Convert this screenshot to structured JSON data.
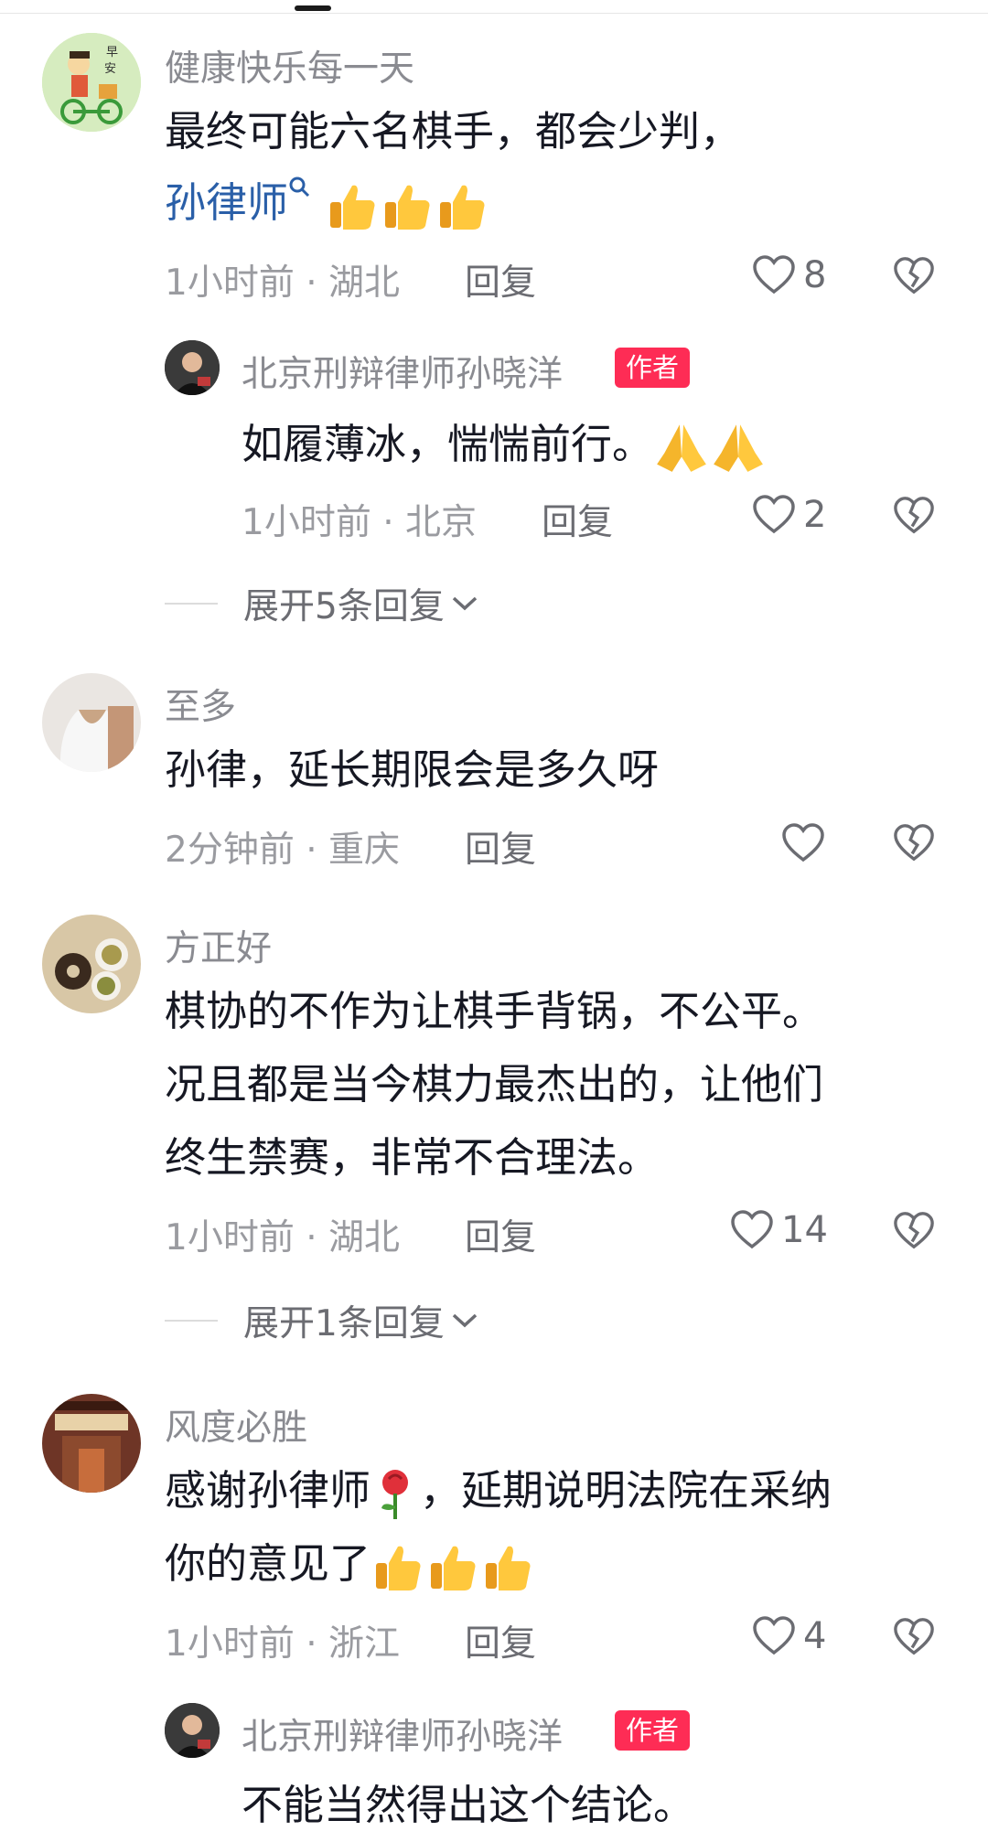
{
  "c1": {
    "user": "健康快乐每一天",
    "avatar_text": [
      "早",
      "安"
    ],
    "line1": "最终可能六名棋手，都会少判，",
    "mention": "孙律师",
    "time": "1小时前 · 湖北",
    "reply": "回复",
    "likes": "8"
  },
  "r1": {
    "user": "北京刑辩律师孙晓洋",
    "badge": "作者",
    "text": "如履薄冰，惴惴前行。",
    "time": "1小时前 · 北京",
    "reply": "回复",
    "likes": "2"
  },
  "e1": {
    "label": "展开5条回复"
  },
  "c2": {
    "user": "至多",
    "text": "孙律，延长期限会是多久呀",
    "time": "2分钟前 · 重庆",
    "reply": "回复"
  },
  "c3": {
    "user": "方正好",
    "line1": "棋协的不作为让棋手背锅，不公平。",
    "line2": "况且都是当今棋力最杰出的，让他们",
    "line3": "终生禁赛，非常不合理法。",
    "time": "1小时前 · 湖北",
    "reply": "回复",
    "likes": "14"
  },
  "e2": {
    "label": "展开1条回复"
  },
  "c4": {
    "user": "风度必胜",
    "line1a": "感谢孙律师",
    "line1b": "，延期说明法院在采纳",
    "line2": "你的意见了",
    "time": "1小时前 · 浙江",
    "reply": "回复",
    "likes": "4"
  },
  "r2": {
    "user": "北京刑辩律师孙晓洋",
    "badge": "作者",
    "text": "不能当然得出这个结论。"
  },
  "colors": {
    "author_badge": "#fe2c55",
    "mention": "#2a5fa8",
    "meta": "#9a9ba0"
  },
  "icons": [
    "heart-icon",
    "broken-heart-icon",
    "thumbs-up-emoji",
    "praying-hands-emoji",
    "rose-emoji",
    "search-icon",
    "chevron-down-icon"
  ]
}
